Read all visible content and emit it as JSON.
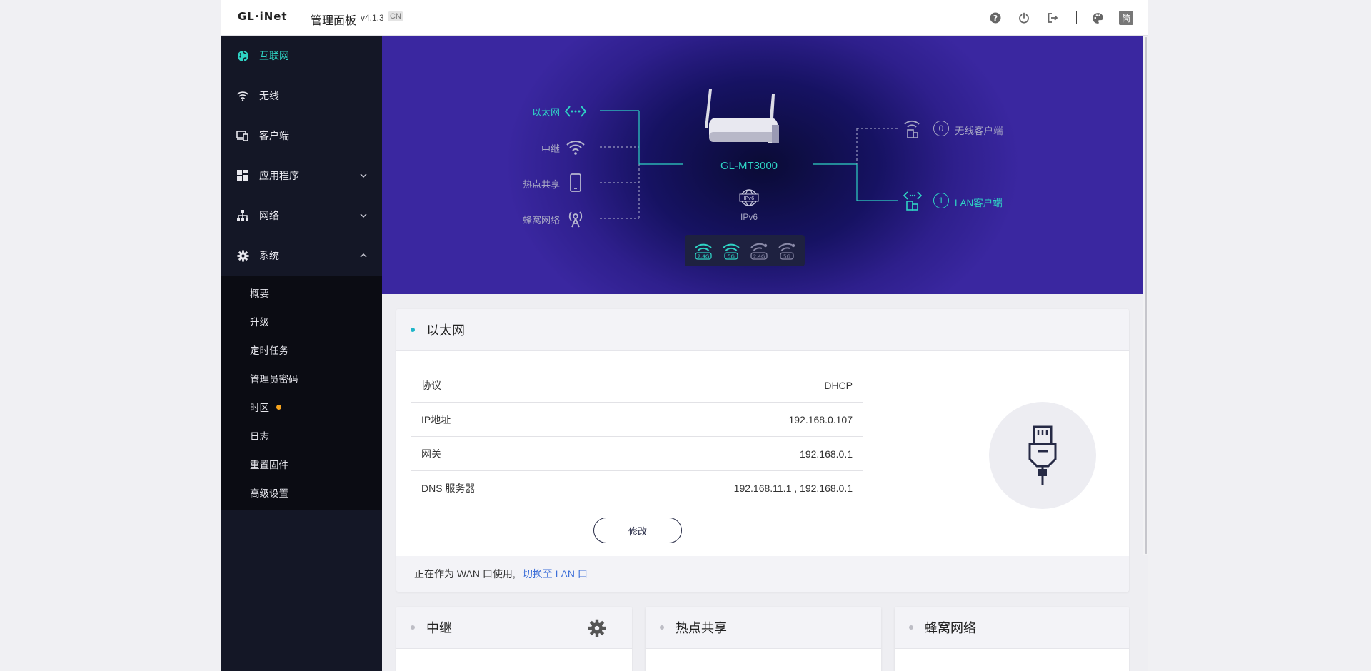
{
  "header": {
    "logo": "GL·iNet",
    "title": "管理面板",
    "version": "v4.1.3",
    "region": "CN",
    "lang_badge": "简",
    "icons": [
      "help-icon",
      "power-icon",
      "logout-icon",
      "theme-palette-icon",
      "language-icon"
    ]
  },
  "sidebar": {
    "items": [
      {
        "label": "互联网",
        "icon": "globe-icon",
        "active": true
      },
      {
        "label": "无线",
        "icon": "wifi-icon"
      },
      {
        "label": "客户端",
        "icon": "devices-icon"
      },
      {
        "label": "应用程序",
        "icon": "apps-grid-icon",
        "expandable": true
      },
      {
        "label": "网络",
        "icon": "network-tree-icon",
        "expandable": true
      },
      {
        "label": "系统",
        "icon": "gear-icon",
        "expanded": true
      }
    ],
    "system_sub": [
      "概要",
      "升级",
      "定时任务",
      "管理员密码",
      "时区",
      "日志",
      "重置固件",
      "高级设置"
    ]
  },
  "topology": {
    "wan": {
      "ethernet": "以太网",
      "repeater": "中继",
      "tethering": "热点共享",
      "cellular": "蜂窝网络"
    },
    "router_name": "GL-MT3000",
    "ipv6_label": "IPv6",
    "wifi_bands": [
      "2.4G",
      "5G",
      "2.4G",
      "5G"
    ],
    "clients": {
      "wireless_count": "0",
      "wireless_label": "无线客户端",
      "lan_count": "1",
      "lan_label": "LAN客户端"
    }
  },
  "ethernet_card": {
    "title": "以太网",
    "rows": [
      {
        "key": "协议",
        "value": "DHCP"
      },
      {
        "key": "IP地址",
        "value": "192.168.0.107"
      },
      {
        "key": "网关",
        "value": "192.168.0.1"
      },
      {
        "key": "DNS 服务器",
        "value": "192.168.11.1 , 192.168.0.1"
      }
    ],
    "edit_label": "修改",
    "footer_text": "正在作为 WAN 口使用,",
    "footer_link": "切换至 LAN 口"
  },
  "cards": {
    "repeater": "中继",
    "tethering": "热点共享",
    "cellular": "蜂窝网络"
  },
  "colors": {
    "accent": "#2fd3c4",
    "sidebar_bg": "#141726",
    "banner_dark": "#0a0b35",
    "banner_edge": "#3a27a0",
    "link": "#3d6fd8",
    "timezone_dot": "#f7a41d"
  }
}
